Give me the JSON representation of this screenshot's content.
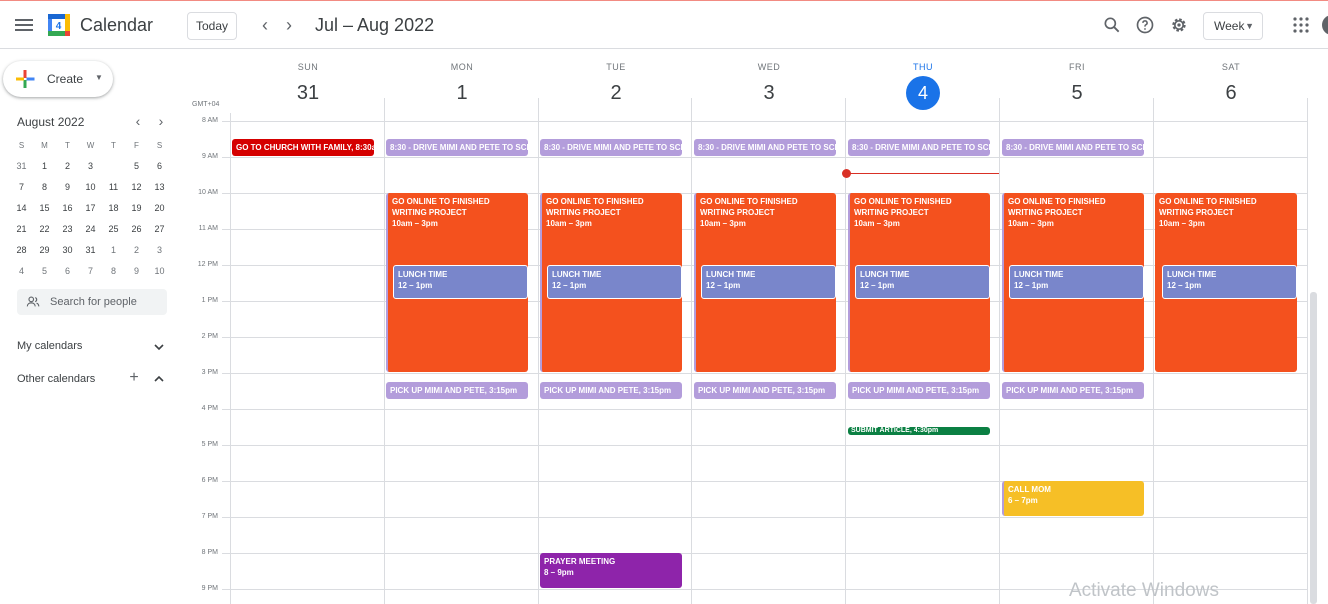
{
  "header": {
    "app_title": "Calendar",
    "logo_number": "4",
    "today_label": "Today",
    "date_range": "Jul – Aug 2022",
    "view_label": "Week"
  },
  "sidebar": {
    "create_label": "Create",
    "mini_calendar": {
      "title": "August 2022",
      "weekday_headers": [
        "S",
        "M",
        "T",
        "W",
        "T",
        "F",
        "S"
      ],
      "weeks": [
        [
          "31",
          "1",
          "2",
          "3",
          "4",
          "5",
          "6"
        ],
        [
          "7",
          "8",
          "9",
          "10",
          "11",
          "12",
          "13"
        ],
        [
          "14",
          "15",
          "16",
          "17",
          "18",
          "19",
          "20"
        ],
        [
          "21",
          "22",
          "23",
          "24",
          "25",
          "26",
          "27"
        ],
        [
          "28",
          "29",
          "30",
          "31",
          "1",
          "2",
          "3"
        ],
        [
          "4",
          "5",
          "6",
          "7",
          "8",
          "9",
          "10"
        ]
      ]
    },
    "people_search_placeholder": "Search for people",
    "my_calendars_label": "My calendars",
    "other_calendars_label": "Other calendars"
  },
  "grid": {
    "timezone": "GMT+04",
    "days": [
      {
        "dow": "SUN",
        "num": "31"
      },
      {
        "dow": "MON",
        "num": "1"
      },
      {
        "dow": "TUE",
        "num": "2"
      },
      {
        "dow": "WED",
        "num": "3"
      },
      {
        "dow": "THU",
        "num": "4",
        "today": true
      },
      {
        "dow": "FRI",
        "num": "5"
      },
      {
        "dow": "SAT",
        "num": "6"
      }
    ],
    "hours": [
      "8 AM",
      "9 AM",
      "10 AM",
      "11 AM",
      "12 PM",
      "1 PM",
      "2 PM",
      "3 PM",
      "4 PM",
      "5 PM",
      "6 PM",
      "7 PM",
      "8 PM",
      "9 PM"
    ]
  },
  "events": {
    "church": "GO TO CHURCH WITH FAMILY, 8:30am",
    "drive": "8:30 - DRIVE MIMI AND PETE TO SCHOOL",
    "project_title": "GO ONLINE TO FINISHED WRITING PROJECT",
    "project_time": "10am – 3pm",
    "lunch_title": "LUNCH TIME",
    "lunch_time": "12 – 1pm",
    "pickup": "PICK UP MIMI AND PETE, 3:15pm",
    "submit": "SUBMIT ARTICLE, 4:30pm",
    "callmom_title": "CALL MOM",
    "callmom_time": "6 – 7pm",
    "prayer_title": "PRAYER MEETING",
    "prayer_time": "8 – 9pm"
  },
  "colors": {
    "accent": "#1a73e8",
    "orange": "#f4511e",
    "lavender": "#b39ddb",
    "lunch": "#7986cb",
    "red": "#d50000",
    "green": "#0b8043",
    "yellow": "#f6bf26",
    "purple": "#8e24aa"
  },
  "watermark": "Activate Windows"
}
